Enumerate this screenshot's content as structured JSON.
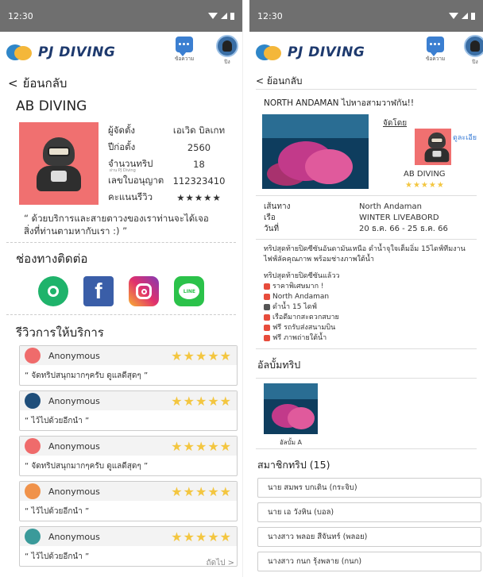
{
  "left": {
    "status_time": "12:30",
    "logo_text": "PJ DIVING",
    "header": {
      "messages_label": "ข้อความ",
      "profile_label": "ปิง"
    },
    "back_label": "ย้อนกลับ",
    "shop_name": "AB DIVING",
    "info": [
      {
        "k": "ผู้จัดตั้ง",
        "v": "เอเวิด บิลเกท"
      },
      {
        "k": "ปีก่อตั้ง",
        "v": "2560"
      },
      {
        "k": "จำนวนทริป",
        "v": "18",
        "sub": "ผ่าน PJ Diving"
      },
      {
        "k": "เลขใบอนุญาต",
        "v": "112323410"
      },
      {
        "k": "คะแนนรีวิว",
        "v": "★★★★★"
      }
    ],
    "quote": "“ ด้วยบริการและสายตาวงของเราท่านจะได้เจอสิ่งที่ท่านตามหากับเรา :) ”",
    "contact_title": "ช่องทางติดต่อ",
    "contacts": {
      "whatsapp": "whatsapp-icon",
      "facebook": "f",
      "instagram": "instagram-icon",
      "line": "LINE"
    },
    "review_title": "รีวิวการให้บริการ",
    "reviews": [
      {
        "name": "Anonymous",
        "stars": "★★★★★",
        "text": "“ จัดทริปสนุกมากๆครับ ดูแลดีสุดๆ ”",
        "color": "#ef6b6b"
      },
      {
        "name": "Anonymous",
        "stars": "★★★★★",
        "text": "“ ไว้ไปด้วยอีกนำ ”",
        "color": "#1f4e7a"
      },
      {
        "name": "Anonymous",
        "stars": "★★★★★",
        "text": "“ จัดทริปสนุกมากๆครับ ดูแลดีสุดๆ ”",
        "color": "#ef6b6b"
      },
      {
        "name": "Anonymous",
        "stars": "★★★★★",
        "text": "“ ไว้ไปด้วยอีกนำ ”",
        "color": "#f0924a"
      },
      {
        "name": "Anonymous",
        "stars": "★★★★★",
        "text": "“ ไว้ไปด้วยอีกนำ ”",
        "color": "#3a9a9a"
      }
    ],
    "next_label": "ถัดไป >"
  },
  "right": {
    "status_time": "12:30",
    "logo_text": "PJ DIVING",
    "header": {
      "messages_label": "ข้อความ",
      "profile_label": "ปิง"
    },
    "back_label": "< ย้อนกลับ",
    "trip_title": "NORTH ANDAMAN ไปหาอสามวาฬกัน!!",
    "organizer_label": "จัดโดย",
    "organizer_link": "ดูละเอีย",
    "organizer_name": "AB DIVING",
    "organizer_stars": "★★★★★",
    "details": [
      {
        "k": "เส้นทาง",
        "v": "North Andaman"
      },
      {
        "k": "เรือ",
        "v": "WINTER LIVEABORD"
      },
      {
        "k": "วันที่",
        "v": "20 ธ.ค. 66 - 25 ธ.ค. 66"
      }
    ],
    "desc_intro": "ทริปสุดท้ายปิดซีซันอันดามันเหนือ ดำน้ำจุใจเต็มอิ่ม 15ไดฟ์ทีมงานไฟฟ์ลัคคุณภาพ พร้อมช่างภาพใต้น้ำ",
    "desc_items": [
      {
        "text": "ทริปสุดท้ายปิดซีซันแล้วว",
        "color": ""
      },
      {
        "text": "ราคาพิเศษมาก !",
        "color": "#e74c3c"
      },
      {
        "text": "North Andaman",
        "color": "#e74c3c"
      },
      {
        "text": "ดำน้ำ 15 ไดฟ์",
        "color": "#555"
      },
      {
        "text": "เรือดีมากสะดวกสบาย",
        "color": "#e74c3c"
      },
      {
        "text": "ฟรี รถรับส่งสนามบิน",
        "color": "#e74c3c"
      },
      {
        "text": "ฟรี ภาพถ่ายใต้น้ำ",
        "color": "#e74c3c"
      }
    ],
    "album_title": "อัลบั้มทริป",
    "album_caption": "อัลบั้ม A",
    "members_title": "สมาชิกทริป (15)",
    "members": [
      "นาย สมพร บกเดิน (กระจิบ)",
      "นาย เอ วังหิน (บอล)",
      "นางสาว พลอย สีจันทร์ (พลอย)",
      "นางสาว กนก รุ้งพลาย (กนก)"
    ]
  }
}
